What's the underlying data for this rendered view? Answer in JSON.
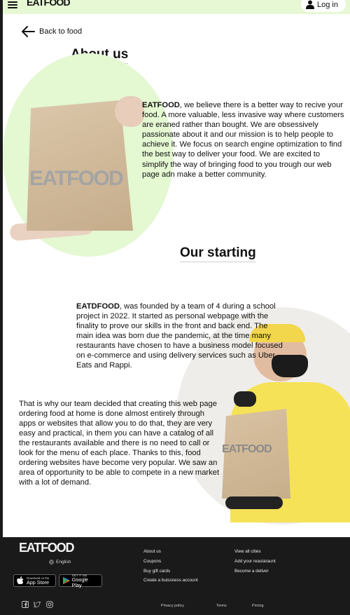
{
  "header": {
    "brand": "EATFOOD",
    "login_label": "Log in"
  },
  "nav": {
    "back_label": "Back to food"
  },
  "about": {
    "title": "About us",
    "brand_name": "EATFOOD",
    "text": ", we believe there is a better way to recive your food. A more valuable, less invasive way where customers are eraned rather than bought. We are obsessively passionate about it and our mission is to help people to achieve it. We focus on search engine optimization to find the best way to deliver your food. We are excited to simplify the way of bringing food to you trough our web page adn make a better community.",
    "bag_logo": "EATFOOD"
  },
  "starting": {
    "title": "Our starting",
    "brand_name": "EATDFOOD",
    "text": ", was founded by a team of 4 during a school project in 2022. It started as personal webpage with the finality to prove our skills in the front and back end. The main idea was born due the pandemic, at the time many restaurants have chosen to have a business model focused on e-commerce and using delivery services such as Uber Eats and Rappi.",
    "text2": "That is why our team decided that creating this web page ordering food at home is done almost entirely through apps or websites that allow you to do that, they are very easy and practical, in them you can have a catalog of all the restaurants available and there is no need to call or look for the menu of each place. Thanks to this, food ordering websites have become very popular. We saw an area of opportunity to be able to compete in a new market with a lot of demand.",
    "bag_logo": "EATFOOD"
  },
  "footer": {
    "brand": "EATFOOD",
    "language": "English",
    "app_store": {
      "small": "Download on the",
      "big": "App Store"
    },
    "google_play": {
      "small": "GET IT ON",
      "big": "Google Play"
    },
    "col1": [
      "About us",
      "Coupons",
      "Buy gift cards",
      "Create a buissness account"
    ],
    "col2": [
      "View all cities",
      "Add your reastaraunt",
      "Become a deliver"
    ],
    "legal": [
      "Privacy policy",
      "Terms",
      "Pricing"
    ],
    "social_icons": [
      "facebook-icon",
      "twitter-icon",
      "instagram-icon"
    ]
  },
  "colors": {
    "header_bg": "#e6f8d4",
    "accent_green": "#e4f8d2",
    "footer_bg": "#1a1a1a"
  }
}
